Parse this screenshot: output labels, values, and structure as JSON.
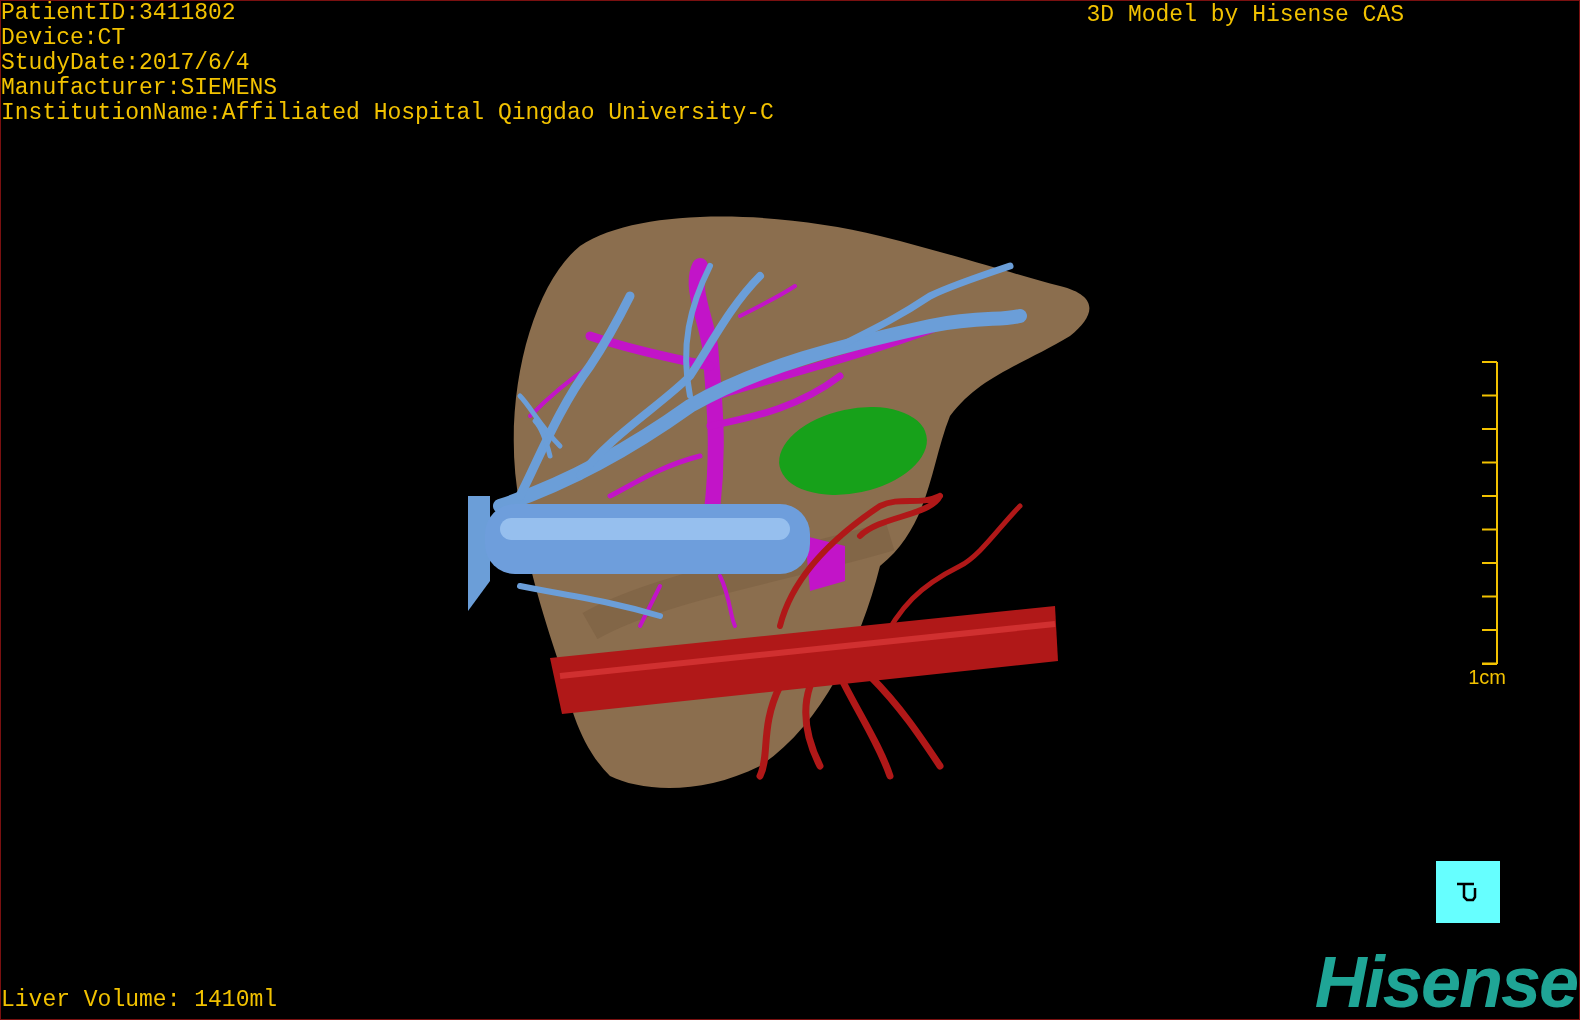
{
  "study_info": [
    "PatientID:3411802",
    "Device:CT",
    "StudyDate:2017/6/4",
    "Manufacturer:SIEMENS",
    "InstitutionName:Affiliated Hospital Qingdao University-C"
  ],
  "title": "3D Model by Hisense CAS",
  "scale": {
    "label": "1cm"
  },
  "volume": "Liver Volume: 1410ml",
  "logo": "Hisense"
}
